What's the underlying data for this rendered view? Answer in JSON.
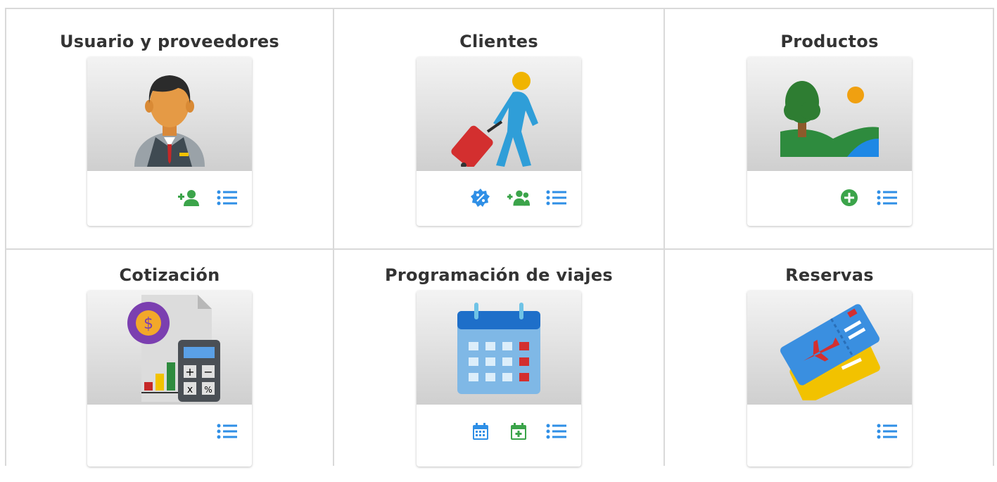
{
  "colors": {
    "border": "#d9d9d9",
    "icon_blue": "#2f8fe6",
    "icon_green": "#3ba44a",
    "title": "#333333"
  },
  "modules": [
    {
      "title": "Usuario y proveedores",
      "image": "business-man-icon",
      "actions": [
        "add-user-icon",
        "list-icon"
      ]
    },
    {
      "title": "Clientes",
      "image": "traveler-luggage-icon",
      "actions": [
        "discount-badge-icon",
        "add-group-icon",
        "list-icon"
      ]
    },
    {
      "title": "Productos",
      "image": "landscape-icon",
      "actions": [
        "plus-circle-icon",
        "list-icon"
      ]
    },
    {
      "title": "Cotización",
      "image": "quote-calculator-icon",
      "actions": [
        "list-icon"
      ]
    },
    {
      "title": "Programación de viajes",
      "image": "calendar-icon",
      "actions": [
        "calendar-view-icon",
        "calendar-add-icon",
        "list-icon"
      ]
    },
    {
      "title": "Reservas",
      "image": "flight-tickets-icon",
      "actions": [
        "list-icon"
      ]
    }
  ]
}
